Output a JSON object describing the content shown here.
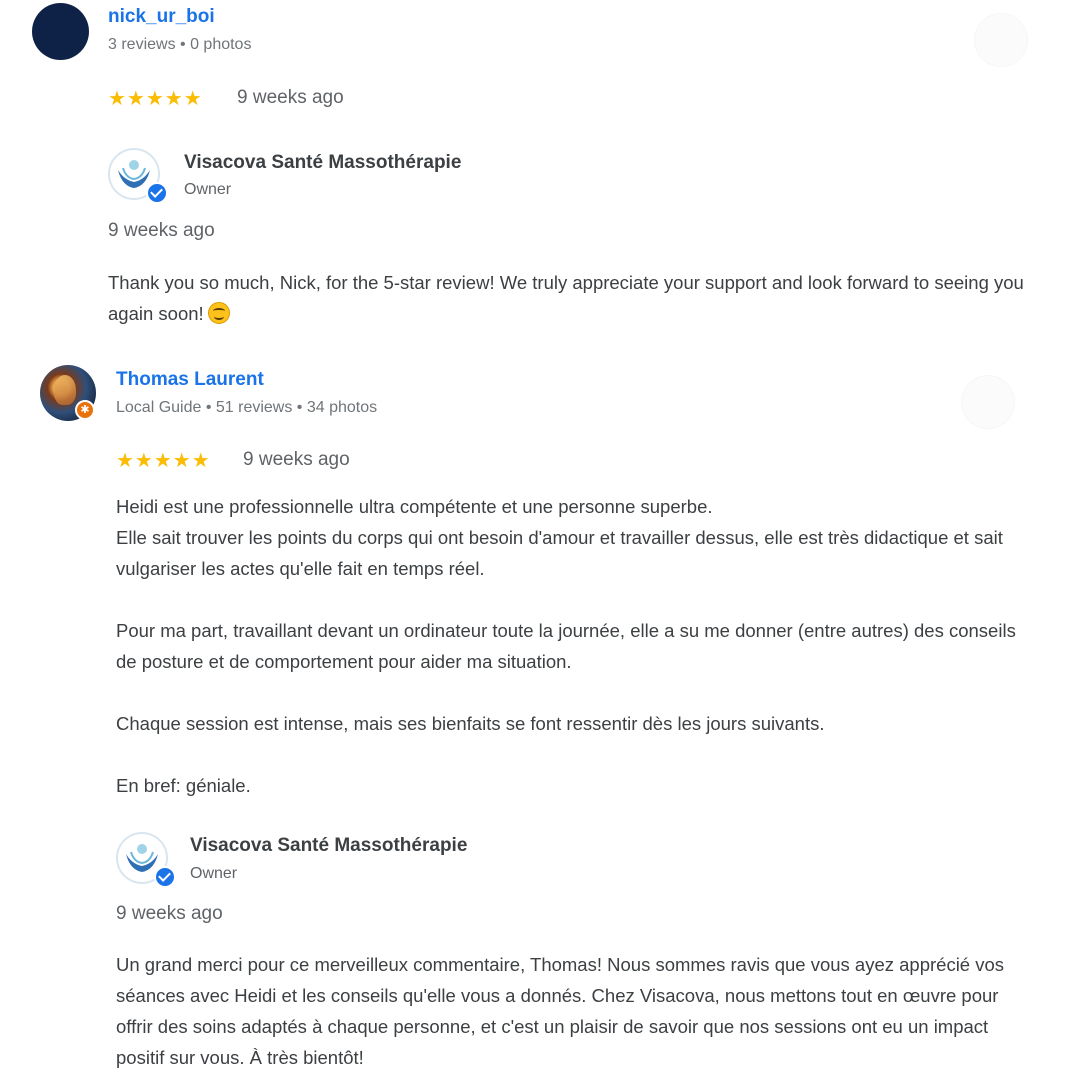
{
  "reviews": [
    {
      "reviewer_name": "nick_ur_boi",
      "reviewer_meta": "3 reviews • 0 photos",
      "stars": "★★★★★",
      "rating": 5,
      "time": "9 weeks ago",
      "text": [],
      "owner_reply": {
        "business_name": "Visacova Santé Massothérapie",
        "role": "Owner",
        "time": "9 weeks ago",
        "text": "Thank you so much, Nick, for the 5-star review! We truly appreciate your support and look forward to seeing you again soon!",
        "emoji": "smiling-face-emoji"
      }
    },
    {
      "reviewer_name": "Thomas Laurent",
      "reviewer_meta": "Local Guide • 51 reviews • 34 photos",
      "stars": "★★★★★",
      "rating": 5,
      "time": "9 weeks ago",
      "text": [
        "Heidi est une professionnelle ultra compétente et une personne superbe.",
        "Elle sait trouver les points du corps qui ont besoin d'amour et travailler dessus, elle est très didactique et sait vulgariser les actes qu'elle fait en temps réel.",
        "Pour ma part, travaillant devant un ordinateur toute la journée, elle a su me donner (entre autres) des conseils de posture et de comportement pour aider ma situation.",
        "Chaque session est intense, mais ses bienfaits se font ressentir dès les jours suivants.",
        "En bref: géniale."
      ],
      "owner_reply": {
        "business_name": "Visacova Santé Massothérapie",
        "role": "Owner",
        "time": "9 weeks ago",
        "text": "Un grand merci pour ce merveilleux commentaire, Thomas! Nous sommes ravis que vous ayez apprécié vos séances avec Heidi et les conseils qu'elle vous a donnés. Chez Visacova, nous mettons tout en œuvre pour offrir des soins adaptés à chaque personne, et c'est un plaisir de savoir que nos sessions ont eu un impact positif sur vous. À très bientôt!"
      }
    }
  ],
  "colors": {
    "link": "#1a73e8",
    "star": "#fbbc04",
    "text": "#3c4043",
    "muted": "#70757a"
  }
}
